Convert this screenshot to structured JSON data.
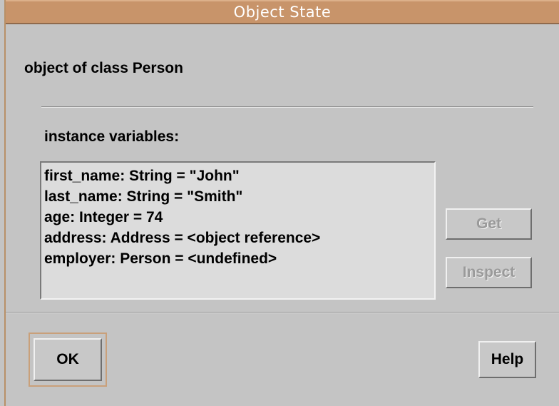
{
  "window": {
    "title": "Object State"
  },
  "dialog": {
    "heading": "object of class Person",
    "vars_label": "instance variables:",
    "variables": [
      "first_name: String = \"John\"",
      "last_name: String = \"Smith\"",
      "age: Integer = 74",
      "address: Address = <object reference>",
      "employer: Person = <undefined>"
    ]
  },
  "buttons": {
    "get": "Get",
    "inspect": "Inspect",
    "ok": "OK",
    "help": "Help"
  },
  "colors": {
    "titlebar": "#c8946a",
    "background": "#c4c4c4",
    "list_background": "#dcdcdc"
  }
}
